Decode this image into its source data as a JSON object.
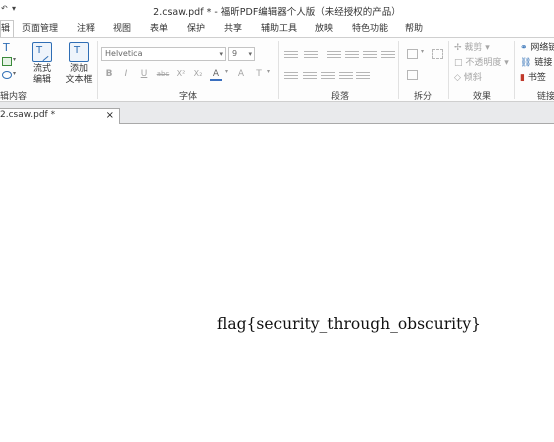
{
  "titlebar": {
    "quick_access": [
      "↶",
      "▾"
    ],
    "title": "2.csaw.pdf * - 福昕PDF编辑器个人版（未经授权的产品）"
  },
  "menu": {
    "tabs": [
      {
        "label": "辑",
        "active": true
      },
      {
        "label": "页面管理"
      },
      {
        "label": "注释"
      },
      {
        "label": "视图"
      },
      {
        "label": "表单"
      },
      {
        "label": "保护"
      },
      {
        "label": "共享"
      },
      {
        "label": "辅助工具"
      },
      {
        "label": "放映"
      },
      {
        "label": "特色功能"
      },
      {
        "label": "帮助"
      }
    ]
  },
  "ribbon": {
    "edit_group": {
      "label": "辑内容",
      "flow_edit": "流式\n编辑",
      "add_textbox": "添加\n文本框"
    },
    "font_group": {
      "label": "字体",
      "font_name": "Helvetica",
      "font_size": "9",
      "format_buttons": [
        "B",
        "I",
        "U",
        "abc",
        "X²",
        "X₂",
        "A",
        "T"
      ]
    },
    "paragraph_group": {
      "label": "段落"
    },
    "split_group": {
      "label": "拆分"
    },
    "effect_group": {
      "label": "效果",
      "items": [
        "裁剪",
        "不透明度",
        "倾斜"
      ]
    },
    "link_group": {
      "label": "链接",
      "items": [
        "网络链接",
        "链接",
        "书签"
      ]
    }
  },
  "doc_tab": {
    "label": "2.csaw.pdf *",
    "close": "×"
  },
  "document": {
    "text": "flag{security_through_obscurity}"
  }
}
